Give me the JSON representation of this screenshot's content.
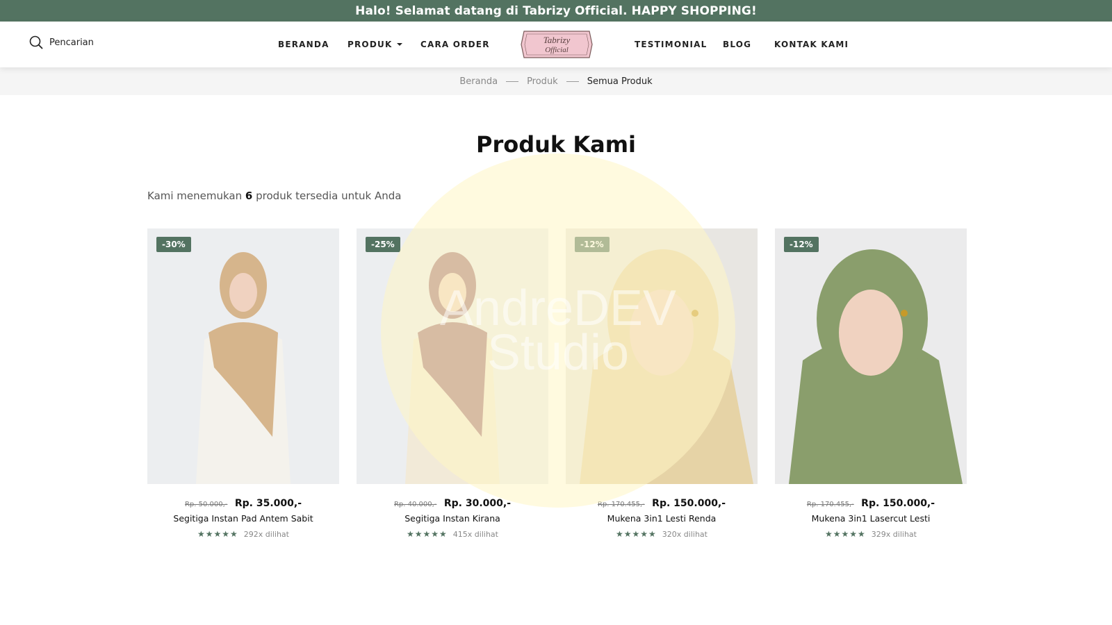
{
  "announcement": "Halo! Selamat datang di Tabrizy Official. HAPPY SHOPPING!",
  "search": {
    "label": "Pencarian"
  },
  "nav": {
    "beranda": "BERANDA",
    "produk": "PRODUK",
    "cara_order": "CARA ORDER",
    "testimonial": "TESTIMONIAL",
    "blog": "BLOG",
    "kontak": "KONTAK KAMI"
  },
  "logo": {
    "line1": "Tabrizy",
    "line2": "Official"
  },
  "breadcrumb": {
    "home": "Beranda",
    "section": "Produk",
    "current": "Semua Produk"
  },
  "watermark": {
    "line1": "AndreDEV",
    "line2": "Studio"
  },
  "page": {
    "title": "Produk Kami",
    "found_prefix": "Kami menemukan",
    "found_count": "6",
    "found_suffix": "produk tersedia untuk Anda"
  },
  "products": [
    {
      "badge": "-30%",
      "old_price": "Rp. 50.000,-",
      "price": "Rp. 35.000,-",
      "name": "Segitiga Instan Pad Antem Sabit",
      "stars": "★★★★★",
      "views": "292x dilihat",
      "bg": "#eceef0",
      "scarf": "#d6b58c",
      "garment": "#f4f2ec"
    },
    {
      "badge": "-25%",
      "old_price": "Rp. 40.000,-",
      "price": "Rp. 30.000,-",
      "name": "Segitiga Instan Kirana",
      "stars": "★★★★★",
      "views": "415x dilihat",
      "bg": "#eceef0",
      "scarf": "#a7767a",
      "garment": "#f2ead8"
    },
    {
      "badge": "-12%",
      "old_price": "Rp. 170.455,-",
      "price": "Rp. 150.000,-",
      "name": "Mukena 3in1 Lesti Renda",
      "stars": "★★★★★",
      "views": "320x dilihat",
      "bg": "#e8e6e2",
      "scarf": "#e6d3a6",
      "garment": "#e6d3a6"
    },
    {
      "badge": "-12%",
      "old_price": "Rp. 170.455,-",
      "price": "Rp. 150.000,-",
      "name": "Mukena 3in1 Lasercut Lesti",
      "stars": "★★★★★",
      "views": "329x dilihat",
      "bg": "#ebebec",
      "scarf": "#8a9e6c",
      "garment": "#8a9e6c"
    }
  ],
  "colors": {
    "brand": "#537361",
    "logo_pink": "#f1c6cf",
    "watermark": "#fff6c4"
  }
}
